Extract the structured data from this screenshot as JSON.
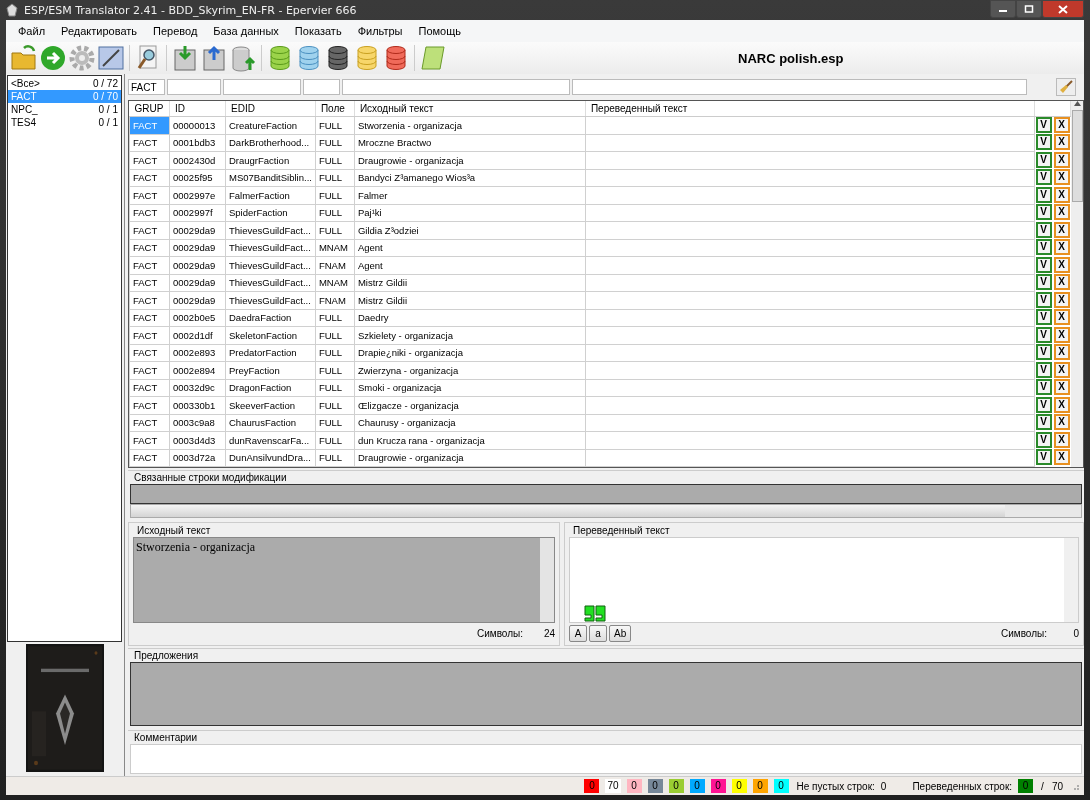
{
  "window": {
    "title": "ESP/ESM Translator 2.41 - BDD_Skyrim_EN-FR - Epervier 666"
  },
  "menu": [
    "Файл",
    "Редактировать",
    "Перевод",
    "База данных",
    "Показать",
    "Фильтры",
    "Помощь"
  ],
  "toolbar": {
    "file_name": "NARC polish.esp"
  },
  "groups": [
    {
      "name": "<Все>",
      "count": "0 / 72",
      "selected": false
    },
    {
      "name": "FACT",
      "count": "0 / 70",
      "selected": true
    },
    {
      "name": "NPC_",
      "count": "0 / 1",
      "selected": false
    },
    {
      "name": "TES4",
      "count": "0 / 1",
      "selected": false
    }
  ],
  "filter": {
    "value": "FACT"
  },
  "table": {
    "columns": [
      "GRUP",
      "ID",
      "EDID",
      "Поле",
      "Исходный текст",
      "Переведенный текст"
    ],
    "rows": [
      {
        "grup": "FACT",
        "id": "00000013",
        "edid": "CreatureFaction",
        "field": "FULL",
        "source": "Stworzenia - organizacja",
        "accept": "V",
        "reject": "X",
        "selected": true
      },
      {
        "grup": "FACT",
        "id": "0001bdb3",
        "edid": "DarkBrotherhood...",
        "field": "FULL",
        "source": "Mroczne Bractwo",
        "accept": "V",
        "reject": "X",
        "selected": false
      },
      {
        "grup": "FACT",
        "id": "0002430d",
        "edid": "DraugrFaction",
        "field": "FULL",
        "source": "Draugrowie - organizacja",
        "accept": "V",
        "reject": "X",
        "selected": false
      },
      {
        "grup": "FACT",
        "id": "00025f95",
        "edid": "MS07BanditSiblin...",
        "field": "FULL",
        "source": "Bandyci Z³amanego Wios³a",
        "accept": "V",
        "reject": "X",
        "selected": false
      },
      {
        "grup": "FACT",
        "id": "0002997e",
        "edid": "FalmerFaction",
        "field": "FULL",
        "source": "Falmer",
        "accept": "V",
        "reject": "X",
        "selected": false
      },
      {
        "grup": "FACT",
        "id": "0002997f",
        "edid": "SpiderFaction",
        "field": "FULL",
        "source": "Paj¹ki",
        "accept": "V",
        "reject": "X",
        "selected": false
      },
      {
        "grup": "FACT",
        "id": "00029da9",
        "edid": "ThievesGuildFact...",
        "field": "FULL",
        "source": "Gildia Z³odziei",
        "accept": "V",
        "reject": "X",
        "selected": false
      },
      {
        "grup": "FACT",
        "id": "00029da9",
        "edid": "ThievesGuildFact...",
        "field": "MNAM",
        "source": "Agent",
        "accept": "V",
        "reject": "X",
        "selected": false
      },
      {
        "grup": "FACT",
        "id": "00029da9",
        "edid": "ThievesGuildFact...",
        "field": "FNAM",
        "source": "Agent",
        "accept": "V",
        "reject": "X",
        "selected": false
      },
      {
        "grup": "FACT",
        "id": "00029da9",
        "edid": "ThievesGuildFact...",
        "field": "MNAM",
        "source": "Mistrz Gildii",
        "accept": "V",
        "reject": "X",
        "selected": false
      },
      {
        "grup": "FACT",
        "id": "00029da9",
        "edid": "ThievesGuildFact...",
        "field": "FNAM",
        "source": "Mistrz Gildii",
        "accept": "V",
        "reject": "X",
        "selected": false
      },
      {
        "grup": "FACT",
        "id": "0002b0e5",
        "edid": "DaedraFaction",
        "field": "FULL",
        "source": "Daedry",
        "accept": "V",
        "reject": "X",
        "selected": false
      },
      {
        "grup": "FACT",
        "id": "0002d1df",
        "edid": "SkeletonFaction",
        "field": "FULL",
        "source": "Szkielety - organizacja",
        "accept": "V",
        "reject": "X",
        "selected": false
      },
      {
        "grup": "FACT",
        "id": "0002e893",
        "edid": "PredatorFaction",
        "field": "FULL",
        "source": "Drapie¿niki - organizacja",
        "accept": "V",
        "reject": "X",
        "selected": false
      },
      {
        "grup": "FACT",
        "id": "0002e894",
        "edid": "PreyFaction",
        "field": "FULL",
        "source": "Zwierzyna - organizacja",
        "accept": "V",
        "reject": "X",
        "selected": false
      },
      {
        "grup": "FACT",
        "id": "00032d9c",
        "edid": "DragonFaction",
        "field": "FULL",
        "source": "Smoki - organizacja",
        "accept": "V",
        "reject": "X",
        "selected": false
      },
      {
        "grup": "FACT",
        "id": "000330b1",
        "edid": "SkeeverFaction",
        "field": "FULL",
        "source": "Œlizgacze - organizacja",
        "accept": "V",
        "reject": "X",
        "selected": false
      },
      {
        "grup": "FACT",
        "id": "0003c9a8",
        "edid": "ChaurusFaction",
        "field": "FULL",
        "source": "Chaurusy - organizacja",
        "accept": "V",
        "reject": "X",
        "selected": false
      },
      {
        "grup": "FACT",
        "id": "0003d4d3",
        "edid": "dunRavenscarFa...",
        "field": "FULL",
        "source": "dun Krucza rana - organizacja",
        "accept": "V",
        "reject": "X",
        "selected": false
      },
      {
        "grup": "FACT",
        "id": "0003d72a",
        "edid": "DunAnsilvundDra...",
        "field": "FULL",
        "source": "Draugrowie - organizacja",
        "accept": "V",
        "reject": "X",
        "selected": false
      }
    ]
  },
  "linked_strings": {
    "title": "Связанные строки модификации"
  },
  "source_panel": {
    "title": "Исходный текст",
    "text": "Stworzenia - organizacja",
    "symbols_label": "Символы:",
    "symbols_count": "24"
  },
  "translation_panel": {
    "title": "Переведенный текст",
    "case_buttons": [
      "A",
      "a",
      "Ab"
    ],
    "symbols_label": "Символы:",
    "symbols_count": "0"
  },
  "suggestions": {
    "title": "Предложения"
  },
  "comments": {
    "title": "Комментарии"
  },
  "status_bar": {
    "chips": [
      {
        "text": "0",
        "color": "#ff0000"
      },
      {
        "text": "70",
        "color": "#ffffff"
      },
      {
        "text": "0",
        "color": "#ffb6c1"
      },
      {
        "text": "0",
        "color": "#778899"
      },
      {
        "text": "0",
        "color": "#9acd32"
      },
      {
        "text": "0",
        "color": "#00aaff"
      },
      {
        "text": "0",
        "color": "#ff1493"
      },
      {
        "text": "0",
        "color": "#ffff00"
      },
      {
        "text": "0",
        "color": "#ffa500"
      },
      {
        "text": "0",
        "color": "#00ffff"
      }
    ],
    "nonempty_label": "Не пустых строк:",
    "nonempty_value": "0",
    "translated_label": "Переведенных строк:",
    "translated": {
      "text": "0",
      "color": "#008000"
    },
    "separator": "/",
    "total": "70"
  }
}
